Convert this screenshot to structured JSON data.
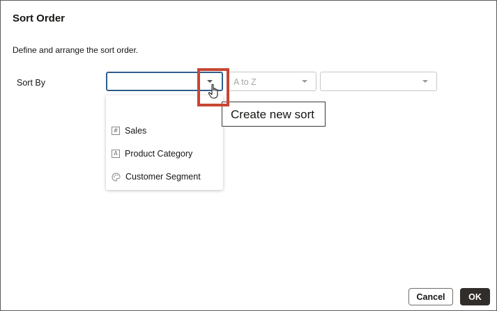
{
  "dialog": {
    "title": "Sort Order",
    "description": "Define and arrange the sort order."
  },
  "sort": {
    "label": "Sort By",
    "column_value": "",
    "order_value": "A to Z",
    "third_value": ""
  },
  "dropdown": {
    "items": [
      {
        "label": "Sales",
        "icon": "number-column-icon"
      },
      {
        "label": "Product Category",
        "icon": "text-column-icon"
      },
      {
        "label": "Customer Segment",
        "icon": "palette-icon"
      }
    ]
  },
  "tooltip": {
    "text": "Create new sort"
  },
  "footer": {
    "cancel_label": "Cancel",
    "ok_label": "OK"
  },
  "colors": {
    "highlight": "#c74634",
    "primary_button": "#312d2a",
    "focus_border": "#2f5d8a"
  }
}
